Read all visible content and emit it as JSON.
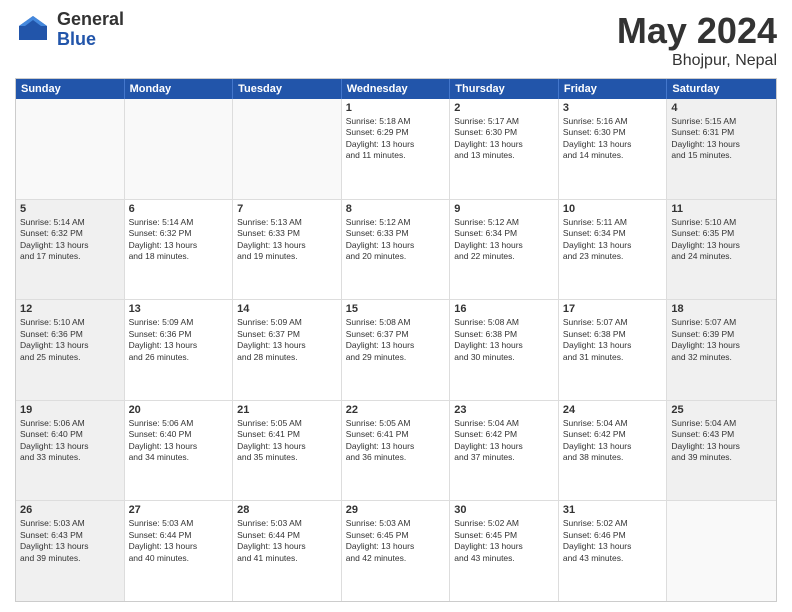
{
  "logo": {
    "general": "General",
    "blue": "Blue"
  },
  "title": {
    "month": "May 2024",
    "location": "Bhojpur, Nepal"
  },
  "header_days": [
    "Sunday",
    "Monday",
    "Tuesday",
    "Wednesday",
    "Thursday",
    "Friday",
    "Saturday"
  ],
  "rows": [
    [
      {
        "day": "",
        "text": "",
        "shaded": false,
        "empty": true
      },
      {
        "day": "",
        "text": "",
        "shaded": false,
        "empty": true
      },
      {
        "day": "",
        "text": "",
        "shaded": false,
        "empty": true
      },
      {
        "day": "1",
        "text": "Sunrise: 5:18 AM\nSunset: 6:29 PM\nDaylight: 13 hours\nand 11 minutes.",
        "shaded": false
      },
      {
        "day": "2",
        "text": "Sunrise: 5:17 AM\nSunset: 6:30 PM\nDaylight: 13 hours\nand 13 minutes.",
        "shaded": false
      },
      {
        "day": "3",
        "text": "Sunrise: 5:16 AM\nSunset: 6:30 PM\nDaylight: 13 hours\nand 14 minutes.",
        "shaded": false
      },
      {
        "day": "4",
        "text": "Sunrise: 5:15 AM\nSunset: 6:31 PM\nDaylight: 13 hours\nand 15 minutes.",
        "shaded": true
      }
    ],
    [
      {
        "day": "5",
        "text": "Sunrise: 5:14 AM\nSunset: 6:32 PM\nDaylight: 13 hours\nand 17 minutes.",
        "shaded": true
      },
      {
        "day": "6",
        "text": "Sunrise: 5:14 AM\nSunset: 6:32 PM\nDaylight: 13 hours\nand 18 minutes.",
        "shaded": false
      },
      {
        "day": "7",
        "text": "Sunrise: 5:13 AM\nSunset: 6:33 PM\nDaylight: 13 hours\nand 19 minutes.",
        "shaded": false
      },
      {
        "day": "8",
        "text": "Sunrise: 5:12 AM\nSunset: 6:33 PM\nDaylight: 13 hours\nand 20 minutes.",
        "shaded": false
      },
      {
        "day": "9",
        "text": "Sunrise: 5:12 AM\nSunset: 6:34 PM\nDaylight: 13 hours\nand 22 minutes.",
        "shaded": false
      },
      {
        "day": "10",
        "text": "Sunrise: 5:11 AM\nSunset: 6:34 PM\nDaylight: 13 hours\nand 23 minutes.",
        "shaded": false
      },
      {
        "day": "11",
        "text": "Sunrise: 5:10 AM\nSunset: 6:35 PM\nDaylight: 13 hours\nand 24 minutes.",
        "shaded": true
      }
    ],
    [
      {
        "day": "12",
        "text": "Sunrise: 5:10 AM\nSunset: 6:36 PM\nDaylight: 13 hours\nand 25 minutes.",
        "shaded": true
      },
      {
        "day": "13",
        "text": "Sunrise: 5:09 AM\nSunset: 6:36 PM\nDaylight: 13 hours\nand 26 minutes.",
        "shaded": false
      },
      {
        "day": "14",
        "text": "Sunrise: 5:09 AM\nSunset: 6:37 PM\nDaylight: 13 hours\nand 28 minutes.",
        "shaded": false
      },
      {
        "day": "15",
        "text": "Sunrise: 5:08 AM\nSunset: 6:37 PM\nDaylight: 13 hours\nand 29 minutes.",
        "shaded": false
      },
      {
        "day": "16",
        "text": "Sunrise: 5:08 AM\nSunset: 6:38 PM\nDaylight: 13 hours\nand 30 minutes.",
        "shaded": false
      },
      {
        "day": "17",
        "text": "Sunrise: 5:07 AM\nSunset: 6:38 PM\nDaylight: 13 hours\nand 31 minutes.",
        "shaded": false
      },
      {
        "day": "18",
        "text": "Sunrise: 5:07 AM\nSunset: 6:39 PM\nDaylight: 13 hours\nand 32 minutes.",
        "shaded": true
      }
    ],
    [
      {
        "day": "19",
        "text": "Sunrise: 5:06 AM\nSunset: 6:40 PM\nDaylight: 13 hours\nand 33 minutes.",
        "shaded": true
      },
      {
        "day": "20",
        "text": "Sunrise: 5:06 AM\nSunset: 6:40 PM\nDaylight: 13 hours\nand 34 minutes.",
        "shaded": false
      },
      {
        "day": "21",
        "text": "Sunrise: 5:05 AM\nSunset: 6:41 PM\nDaylight: 13 hours\nand 35 minutes.",
        "shaded": false
      },
      {
        "day": "22",
        "text": "Sunrise: 5:05 AM\nSunset: 6:41 PM\nDaylight: 13 hours\nand 36 minutes.",
        "shaded": false
      },
      {
        "day": "23",
        "text": "Sunrise: 5:04 AM\nSunset: 6:42 PM\nDaylight: 13 hours\nand 37 minutes.",
        "shaded": false
      },
      {
        "day": "24",
        "text": "Sunrise: 5:04 AM\nSunset: 6:42 PM\nDaylight: 13 hours\nand 38 minutes.",
        "shaded": false
      },
      {
        "day": "25",
        "text": "Sunrise: 5:04 AM\nSunset: 6:43 PM\nDaylight: 13 hours\nand 39 minutes.",
        "shaded": true
      }
    ],
    [
      {
        "day": "26",
        "text": "Sunrise: 5:03 AM\nSunset: 6:43 PM\nDaylight: 13 hours\nand 39 minutes.",
        "shaded": true
      },
      {
        "day": "27",
        "text": "Sunrise: 5:03 AM\nSunset: 6:44 PM\nDaylight: 13 hours\nand 40 minutes.",
        "shaded": false
      },
      {
        "day": "28",
        "text": "Sunrise: 5:03 AM\nSunset: 6:44 PM\nDaylight: 13 hours\nand 41 minutes.",
        "shaded": false
      },
      {
        "day": "29",
        "text": "Sunrise: 5:03 AM\nSunset: 6:45 PM\nDaylight: 13 hours\nand 42 minutes.",
        "shaded": false
      },
      {
        "day": "30",
        "text": "Sunrise: 5:02 AM\nSunset: 6:45 PM\nDaylight: 13 hours\nand 43 minutes.",
        "shaded": false
      },
      {
        "day": "31",
        "text": "Sunrise: 5:02 AM\nSunset: 6:46 PM\nDaylight: 13 hours\nand 43 minutes.",
        "shaded": false
      },
      {
        "day": "",
        "text": "",
        "shaded": false,
        "empty": true
      }
    ]
  ]
}
